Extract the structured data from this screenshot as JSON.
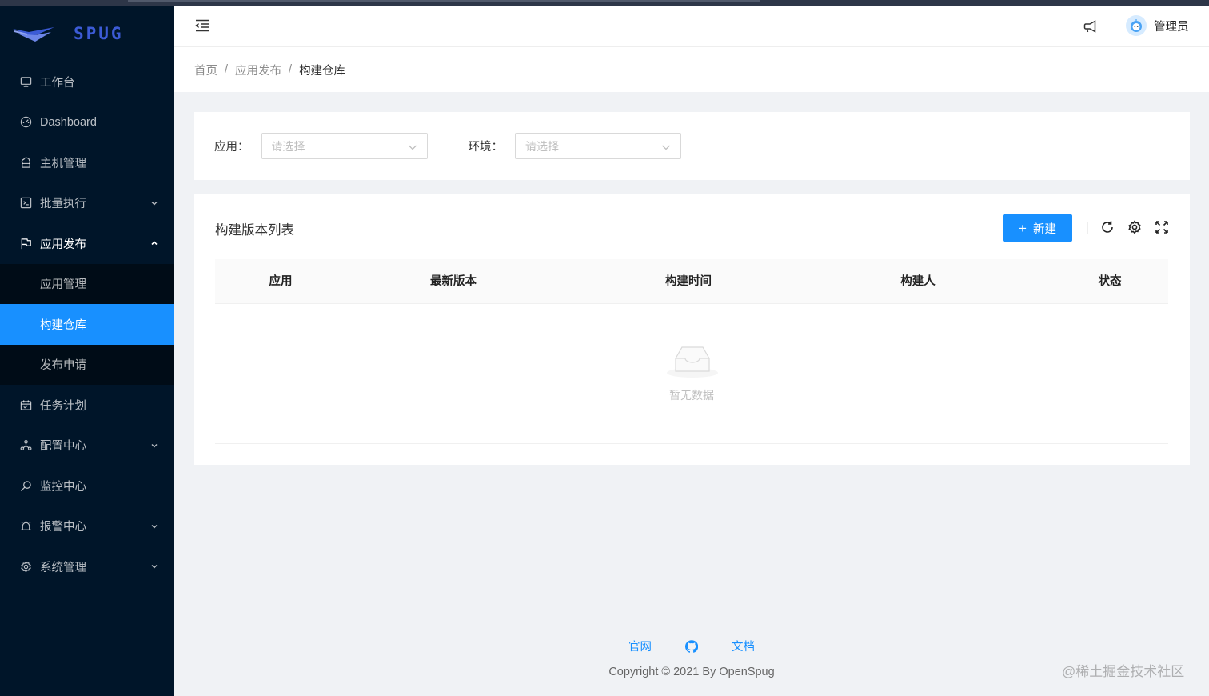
{
  "brand": {
    "logo_text": "SPUG",
    "logo_color": "#3c5bd6"
  },
  "sidebar": {
    "items": [
      {
        "label": "工作台",
        "icon": "desktop-icon"
      },
      {
        "label": "Dashboard",
        "icon": "dashboard-icon"
      },
      {
        "label": "主机管理",
        "icon": "cloud-server-icon"
      },
      {
        "label": "批量执行",
        "icon": "code-icon",
        "expandable": true
      },
      {
        "label": "应用发布",
        "icon": "flag-icon",
        "expandable": true,
        "expanded": true,
        "children": [
          {
            "label": "应用管理"
          },
          {
            "label": "构建仓库",
            "active": true
          },
          {
            "label": "发布申请"
          }
        ]
      },
      {
        "label": "任务计划",
        "icon": "schedule-icon"
      },
      {
        "label": "配置中心",
        "icon": "deployment-icon",
        "expandable": true
      },
      {
        "label": "监控中心",
        "icon": "monitor-icon"
      },
      {
        "label": "报警中心",
        "icon": "alert-icon",
        "expandable": true
      },
      {
        "label": "系统管理",
        "icon": "setting-icon",
        "expandable": true
      }
    ]
  },
  "header": {
    "user_name": "管理员"
  },
  "breadcrumb": [
    "首页",
    "应用发布",
    "构建仓库"
  ],
  "filters": {
    "app": {
      "label": "应用：",
      "placeholder": "请选择"
    },
    "env": {
      "label": "环境：",
      "placeholder": "请选择"
    }
  },
  "table": {
    "title": "构建版本列表",
    "new_button": "新建",
    "columns": [
      "应用",
      "最新版本",
      "构建时间",
      "构建人",
      "状态"
    ],
    "rows": [],
    "empty_text": "暂无数据"
  },
  "footer": {
    "links": [
      "官网",
      "文档"
    ],
    "copyright": "Copyright © 2021 By OpenSpug"
  },
  "watermark": "@稀土掘金技术社区",
  "colors": {
    "primary": "#1890ff",
    "sidebar_bg": "#001529",
    "submenu_bg": "#000c17"
  }
}
